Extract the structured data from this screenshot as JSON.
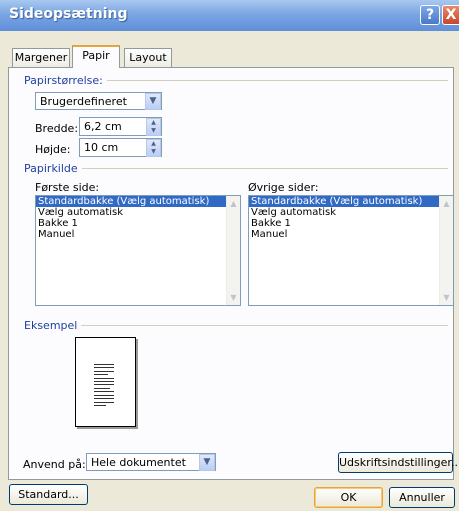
{
  "window": {
    "title": "Sideopsætning",
    "help_glyph": "?",
    "close_glyph": "X"
  },
  "tabs": [
    {
      "label": "Margener",
      "active": false
    },
    {
      "label": "Papir",
      "active": true
    },
    {
      "label": "Layout",
      "active": false
    }
  ],
  "paper_size": {
    "section_label": "Papirstørrelse:",
    "selected": "Brugerdefineret",
    "width_label": "Bredde:",
    "width_value": "6,2 cm",
    "height_label": "Højde:",
    "height_value": "10 cm"
  },
  "paper_source": {
    "section_label": "Papirkilde",
    "first_page_label": "Første side:",
    "other_pages_label": "Øvrige sider:",
    "options": [
      "Standardbakke (Vælg automatisk)",
      "Vælg automatisk",
      "Bakke 1",
      "Manuel"
    ],
    "selected_index": 0
  },
  "preview": {
    "section_label": "Eksempel"
  },
  "apply_to": {
    "label": "Anvend på:",
    "selected": "Hele dokumentet"
  },
  "buttons": {
    "print_options": "Udskriftsindstillinger...",
    "default": "Standard...",
    "ok": "OK",
    "cancel": "Annuller"
  },
  "colors": {
    "title_bar": "#7ba6e3",
    "selection": "#316ac5",
    "section_label": "#1f3fa0",
    "dialog_bg": "#ece9d8"
  }
}
